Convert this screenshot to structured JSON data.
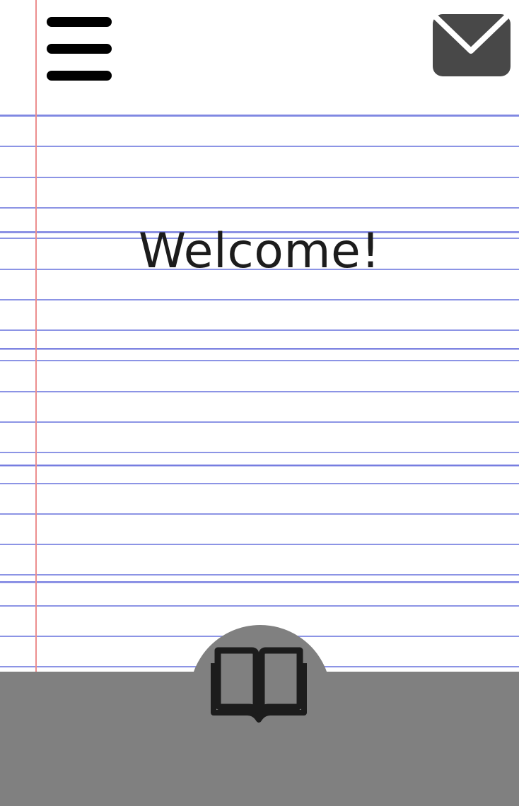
{
  "header": {
    "menu_icon": "hamburger-menu-icon",
    "mail_icon": "envelope-icon"
  },
  "main": {
    "welcome_text": "Welcome!"
  },
  "bottom_nav": {
    "center_icon": "open-book-icon"
  },
  "colors": {
    "paper": "#ffffff",
    "rule_line": "#8088e2",
    "margin_line": "#ec8e8e",
    "icon_dark": "#484848",
    "bottom_bar": "#808080",
    "text": "#1c1c1c"
  }
}
